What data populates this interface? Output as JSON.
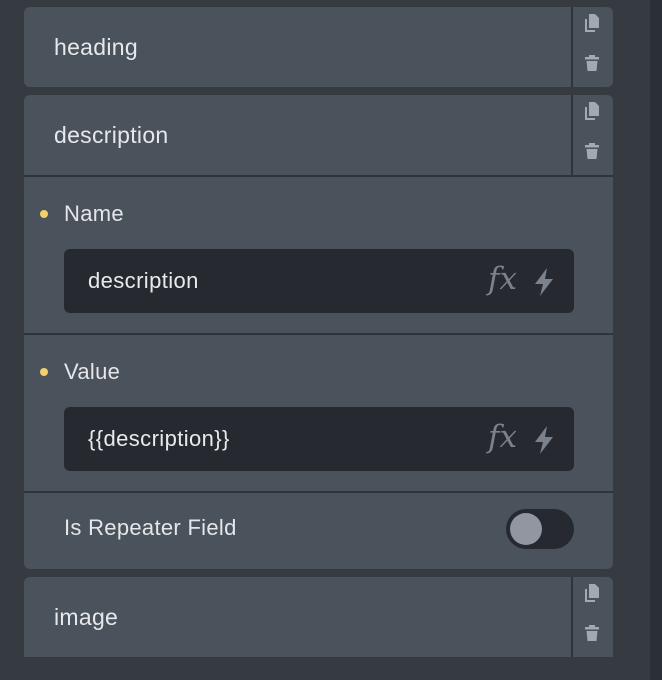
{
  "repeater_items": {
    "heading": {
      "title": "heading"
    },
    "description": {
      "title": "description"
    },
    "image": {
      "title": "image"
    }
  },
  "description_fields": {
    "name": {
      "label": "Name",
      "value": "description"
    },
    "value": {
      "label": "Value",
      "value": "{{description}}"
    },
    "is_repeater_field": {
      "label": "Is Repeater Field",
      "checked": false
    }
  },
  "input_icons": {
    "fx": "fx",
    "bolt": "lightning-bolt-icon"
  },
  "action_icons": [
    "copy-icon",
    "trash-icon"
  ],
  "colors": {
    "background": "#363b42",
    "panel": "#4a525b",
    "input": "#262a30",
    "required_dot": "#f2d06b"
  }
}
